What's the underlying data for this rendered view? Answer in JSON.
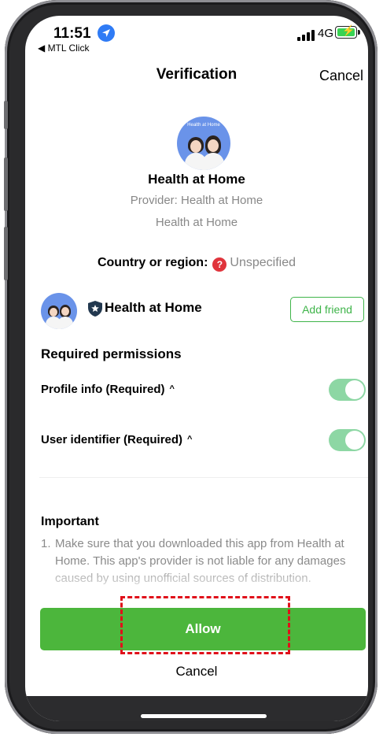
{
  "status_bar": {
    "time": "11:51",
    "back_app": "◀ MTL Click",
    "network": "4G"
  },
  "nav": {
    "title": "Verification",
    "cancel": "Cancel"
  },
  "app": {
    "logo_text": "Health at Home",
    "name": "Health at Home",
    "provider": "Provider: Health at Home",
    "subtitle": "Health at Home"
  },
  "country": {
    "label": "Country or region:",
    "icon": "?",
    "value": "Unspecified"
  },
  "friend": {
    "name": "Health at Home",
    "add_button": "Add friend"
  },
  "permissions": {
    "title": "Required permissions",
    "items": [
      {
        "label": "Profile info (Required)",
        "enabled": true
      },
      {
        "label": "User identifier (Required)",
        "enabled": true
      }
    ]
  },
  "important": {
    "title": "Important",
    "number": "1.",
    "text": "Make sure that you downloaded this app from Health at Home. This app's provider is not liable for any damages caused by using unofficial sources of distribution."
  },
  "actions": {
    "allow": "Allow",
    "cancel": "Cancel"
  },
  "colors": {
    "accent_green": "#4cb63c",
    "toggle_green": "#8dd7a4",
    "highlight_red": "#e0101a"
  }
}
